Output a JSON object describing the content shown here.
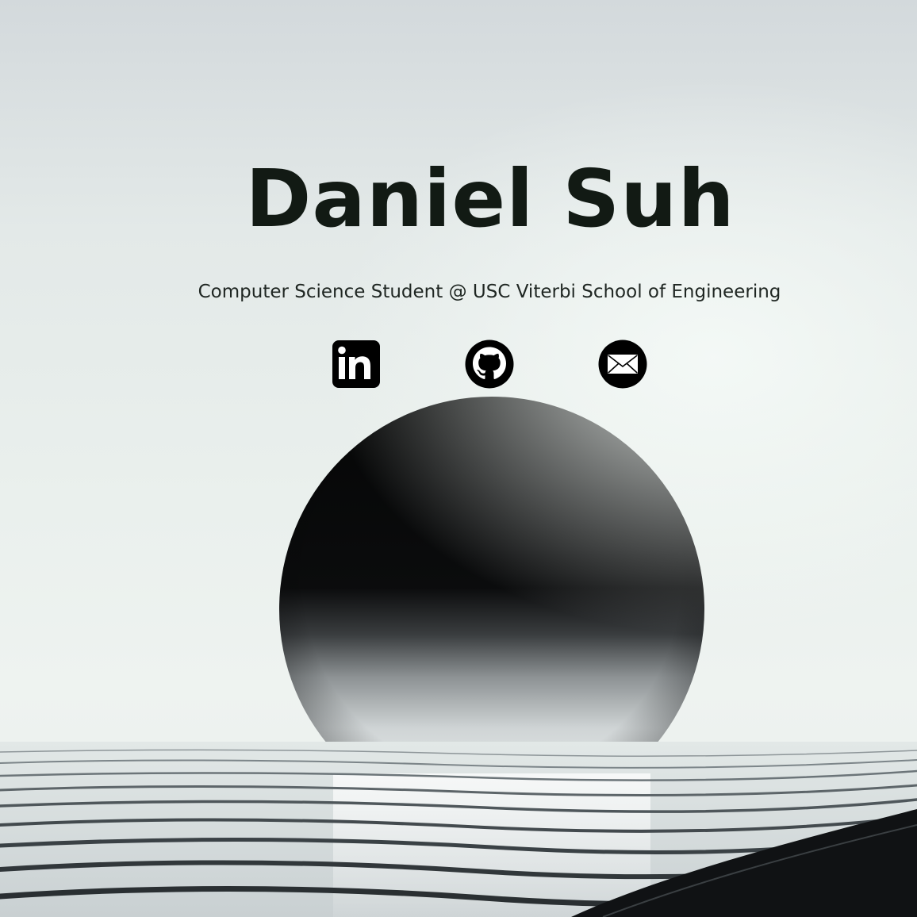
{
  "header": {
    "name": "Daniel Suh",
    "tagline": "Computer Science Student @ USC Viterbi School of Engineering"
  },
  "social_links": [
    {
      "label": "LinkedIn",
      "icon": "linkedin-icon"
    },
    {
      "label": "GitHub",
      "icon": "github-icon"
    },
    {
      "label": "Email",
      "icon": "mail-icon"
    }
  ],
  "colors": {
    "text": "#121a14",
    "icon": "#000000",
    "background": "#e6ecea"
  }
}
